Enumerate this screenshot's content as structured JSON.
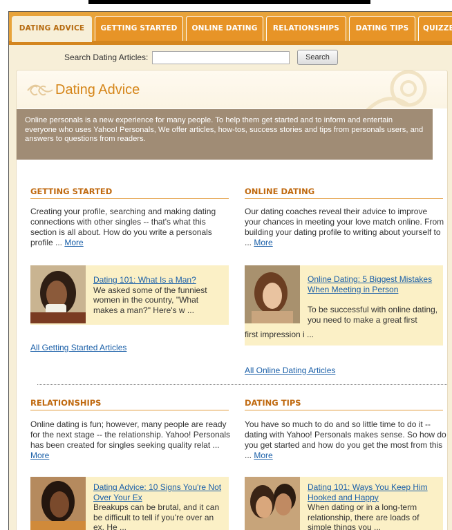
{
  "tabs": [
    {
      "label": "DATING ADVICE",
      "active": true
    },
    {
      "label": "GETTING STARTED",
      "active": false
    },
    {
      "label": "ONLINE DATING",
      "active": false
    },
    {
      "label": "RELATIONSHIPS",
      "active": false
    },
    {
      "label": "DATING TIPS",
      "active": false
    },
    {
      "label": "QUIZZE",
      "active": false
    }
  ],
  "search": {
    "label": "Search Dating Articles:",
    "value": "",
    "button": "Search"
  },
  "page_title": "Dating Advice",
  "intro": "Online personals is a new experience for many people. To help them get started and to inform and entertain everyone who uses Yahoo! Personals, We offer articles, how-tos, success stories and tips from personals users, and answers to questions from readers.",
  "more_label": "More",
  "sections": {
    "getting_started": {
      "heading": "GETTING STARTED",
      "text": "Creating your profile, searching and making dating connections with other singles -- that's what this section is all about. How do you write a personals profile ...",
      "feature_link": "Dating 101: What Is a Man?",
      "feature_text": "We asked some of the funniest women in the country, \"What makes a man?\" Here's w ...",
      "all_link": "All Getting Started Articles"
    },
    "online_dating": {
      "heading": "ONLINE DATING",
      "text": "Our dating coaches reveal their advice to improve your chances in meeting your love match online. From building your dating profile to writing about yourself to ...",
      "feature_link": "Online Dating: 5 Biggest Mistakes When Meeting in Person",
      "feature_text": "To be successful with online dating, you need to make a great first impression i ...",
      "all_link": "All Online Dating Articles"
    },
    "relationships": {
      "heading": "RELATIONSHIPS",
      "text": "Online dating is fun; however, many people are ready for the next stage -- the relationship. Yahoo! Personals has been created for singles seeking quality relat ...",
      "feature_link": "Dating Advice: 10 Signs You're Not Over Your Ex",
      "feature_text": "Breakups can be brutal, and it can be difficult to tell if you're over an ex. He ..."
    },
    "dating_tips": {
      "heading": "DATING TIPS",
      "text": "You have so much to do and so little time to do it -- dating with Yahoo! Personals makes sense. So how do you get started and how do you get the most from this ...",
      "feature_link": "Dating 101: Ways You Keep Him Hooked and Happy",
      "feature_text": "When dating or in a long-term relationship, there are loads of simple things you ..."
    }
  },
  "colors": {
    "tab_orange": "#e79427",
    "heading_orange": "#c06a10",
    "link_blue": "#1a5fa8",
    "intro_bg": "#a08c75",
    "feature_bg": "#fbf0c6"
  }
}
